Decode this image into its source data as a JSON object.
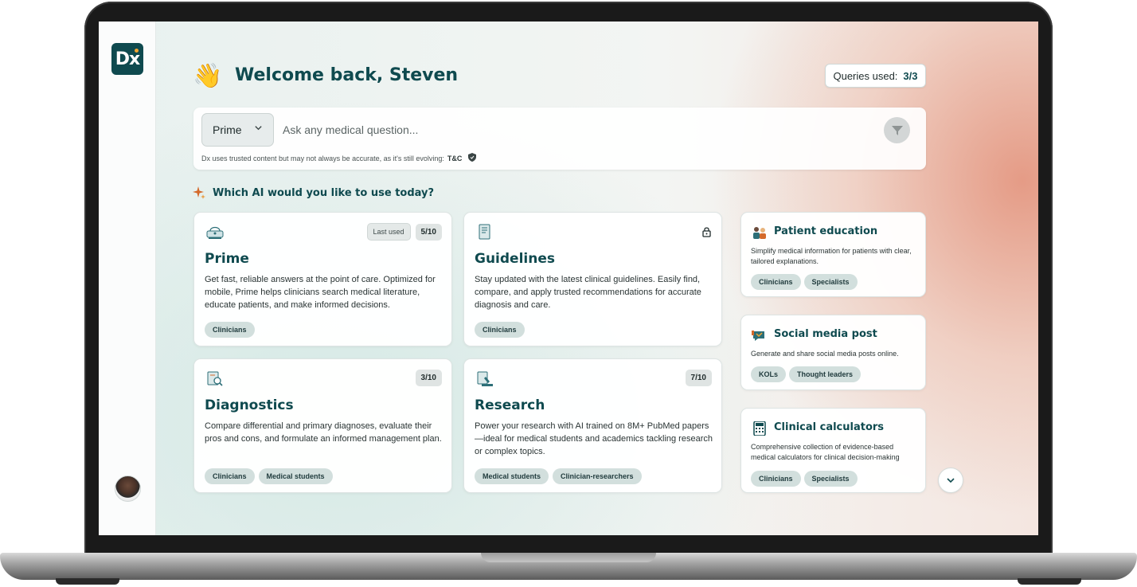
{
  "app": {
    "logo_text": "Dx",
    "accent_color": "#0f4a4f"
  },
  "header": {
    "welcome": "Welcome back, Steven",
    "queries_label": "Queries used:",
    "queries_value": "3/3"
  },
  "search": {
    "model": "Prime",
    "placeholder": "Ask any medical question...",
    "disclaimer": "Dx uses trusted content but may not always be accurate, as it's still evolving:",
    "tc_link": "T&C"
  },
  "section": {
    "title": "Which AI would you like to use today?"
  },
  "main_cards": [
    {
      "title": "Prime",
      "icon": "prime-icon",
      "last_used": "Last used",
      "count": "5/10",
      "description": "Get fast, reliable answers at the point of care. Optimized for mobile, Prime helps clinicians search medical literature, educate patients, and make informed decisions.",
      "tags": [
        "Clinicians"
      ]
    },
    {
      "title": "Guidelines",
      "icon": "guidelines-icon",
      "locked": true,
      "description": "Stay updated with the latest clinical guidelines. Easily find, compare, and apply trusted recommendations for accurate diagnosis and care.",
      "tags": [
        "Clinicians"
      ]
    },
    {
      "title": "Diagnostics",
      "icon": "diagnostics-icon",
      "count": "3/10",
      "description": "Compare differential and primary diagnoses, evaluate their pros and cons, and formulate an informed management plan.",
      "tags": [
        "Clinicians",
        "Medical students"
      ]
    },
    {
      "title": "Research",
      "icon": "research-icon",
      "count": "7/10",
      "description": "Power your research with AI trained on 8M+ PubMed papers—ideal for medical students and academics tackling research or complex topics.",
      "tags": [
        "Medical students",
        "Clinician-researchers"
      ]
    }
  ],
  "side_cards": [
    {
      "title": "Patient education",
      "icon": "patient-education-icon",
      "description": "Simplify medical information for patients with clear, tailored explanations.",
      "tags": [
        "Clinicians",
        "Specialists"
      ]
    },
    {
      "title": "Social media post",
      "icon": "social-media-icon",
      "description": "Generate and share social media posts online.",
      "tags": [
        "KOLs",
        "Thought leaders"
      ]
    },
    {
      "title": "Clinical calculators",
      "icon": "calculator-icon",
      "description": "Comprehensive collection of evidence-based medical calculators for clinical decision-making",
      "tags": [
        "Clinicians",
        "Specialists"
      ]
    }
  ]
}
